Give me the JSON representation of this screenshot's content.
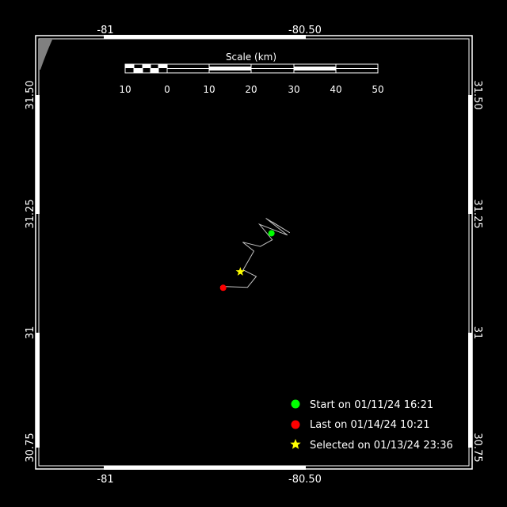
{
  "map": {
    "lon_labels": [
      "-81",
      "-80.50"
    ],
    "lat_labels": [
      "31.50",
      "31.25",
      "31",
      "30.75"
    ],
    "background_color": "#000000",
    "frame_color": "#ffffff",
    "land_color": "#808080",
    "track_color": "#c0c0c0"
  },
  "scale_bar": {
    "title": "Scale (km)",
    "ticks": [
      "10",
      "0",
      "10",
      "20",
      "30",
      "40",
      "50"
    ]
  },
  "track": {
    "points": [
      [
        -80.582,
        31.23
      ],
      [
        -80.538,
        31.207
      ],
      [
        -80.598,
        31.238
      ],
      [
        -80.544,
        31.202
      ],
      [
        -80.614,
        31.225
      ],
      [
        -80.582,
        31.192
      ],
      [
        -80.612,
        31.178
      ],
      [
        -80.656,
        31.187
      ],
      [
        -80.628,
        31.168
      ],
      [
        -80.655,
        31.128
      ],
      [
        -80.622,
        31.114
      ],
      [
        -80.644,
        31.091
      ],
      [
        -80.712,
        31.093
      ]
    ],
    "start": {
      "lon": -80.584,
      "lat": 31.206
    },
    "last": {
      "lon": -80.705,
      "lat": 31.09
    },
    "selected": {
      "lon": -80.662,
      "lat": 31.124
    }
  },
  "legend": {
    "start_label": "Start on 01/11/24 16:21",
    "last_label": "Last on 01/14/24 10:21",
    "selected_label": "Selected on 01/13/24 23:36",
    "start_color": "#00ff00",
    "last_color": "#ff0000",
    "selected_color": "#ffff00"
  }
}
